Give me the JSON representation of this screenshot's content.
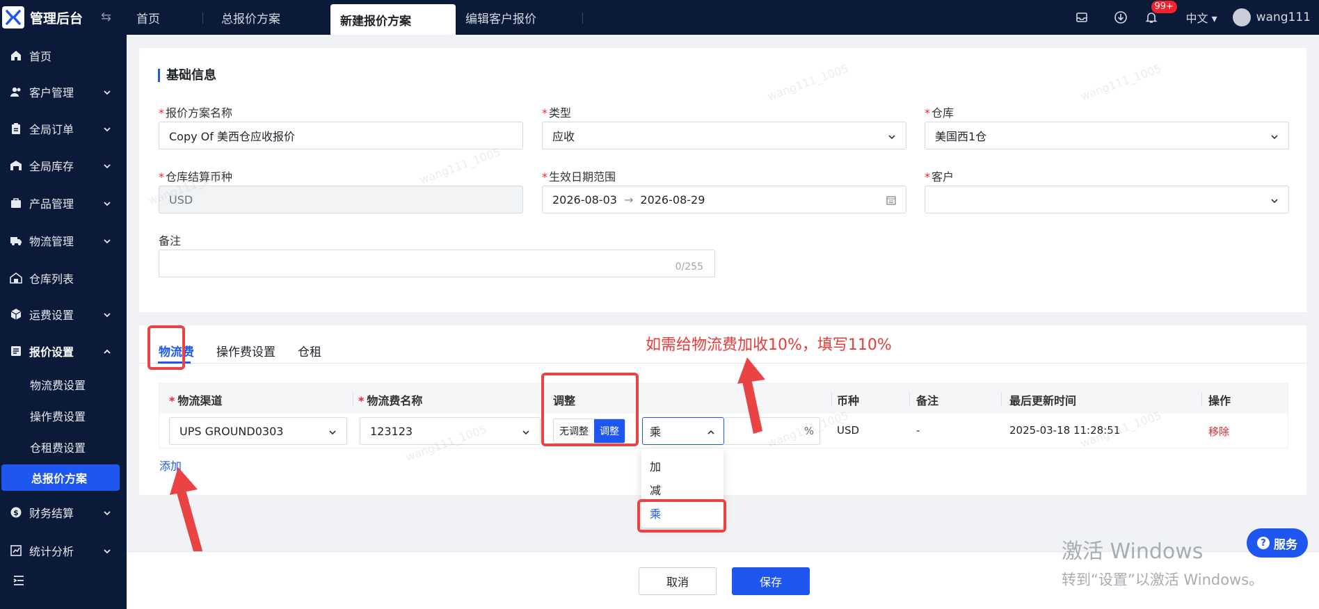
{
  "app": {
    "title": "管理后台"
  },
  "tabs": [
    {
      "label": "首页"
    },
    {
      "label": "总报价方案"
    },
    {
      "label": "新建报价方案"
    },
    {
      "label": "编辑客户报价"
    }
  ],
  "header": {
    "badge": "99+",
    "lang": "中文",
    "username": "wang111"
  },
  "sidebar": {
    "items": [
      {
        "label": "首页"
      },
      {
        "label": "客户管理"
      },
      {
        "label": "全局订单"
      },
      {
        "label": "全局库存"
      },
      {
        "label": "产品管理"
      },
      {
        "label": "物流管理"
      },
      {
        "label": "仓库列表"
      },
      {
        "label": "运费设置"
      },
      {
        "label": "报价设置"
      },
      {
        "label": "财务结算"
      },
      {
        "label": "统计分析"
      }
    ],
    "subitems": [
      {
        "label": "物流费设置"
      },
      {
        "label": "操作费设置"
      },
      {
        "label": "仓租费设置"
      },
      {
        "label": "总报价方案"
      }
    ]
  },
  "basic": {
    "title": "基础信息",
    "name_label": "报价方案名称",
    "name_value": "Copy Of 美西仓应收报价",
    "type_label": "类型",
    "type_value": "应收",
    "warehouse_label": "仓库",
    "warehouse_value": "美国西1仓",
    "currency_label": "仓库结算币种",
    "currency_value": "USD",
    "date_label": "生效日期范围",
    "date_start": "2026-08-03",
    "date_end": "2026-08-29",
    "customer_label": "客户",
    "customer_value": "",
    "remark_label": "备注",
    "remark_counter": "0/255"
  },
  "fee_tabs": [
    {
      "label": "物流费"
    },
    {
      "label": "操作费设置"
    },
    {
      "label": "仓租"
    }
  ],
  "table": {
    "headers": {
      "channel": "物流渠道",
      "fee_name": "物流费名称",
      "adjust": "调整",
      "currency": "币种",
      "remark": "备注",
      "updated": "最后更新时间",
      "action": "操作"
    },
    "row": {
      "channel": "UPS GROUND0303",
      "fee_name": "123123",
      "no_adjust": "无调整",
      "adjust": "调整",
      "operator": "乘",
      "percent_suffix": "%",
      "currency": "USD",
      "remark": "-",
      "updated": "2025-03-18 11:28:51",
      "remove": "移除"
    },
    "add": "添加"
  },
  "dropdown": {
    "options": [
      "加",
      "减",
      "乘"
    ],
    "selected": "乘"
  },
  "annotation": "如需给物流费加收10%，填写110%",
  "footer": {
    "cancel": "取消",
    "save": "保存"
  },
  "watermark": "wang111_1005",
  "activate": {
    "line1": "激活 Windows",
    "line2": "转到“设置”以激活 Windows。"
  },
  "service": {
    "label": "服务"
  },
  "colors": {
    "brand": "#1e56f0",
    "nav_bg": "#0c1a3a",
    "annotation_red": "#ea4343"
  }
}
